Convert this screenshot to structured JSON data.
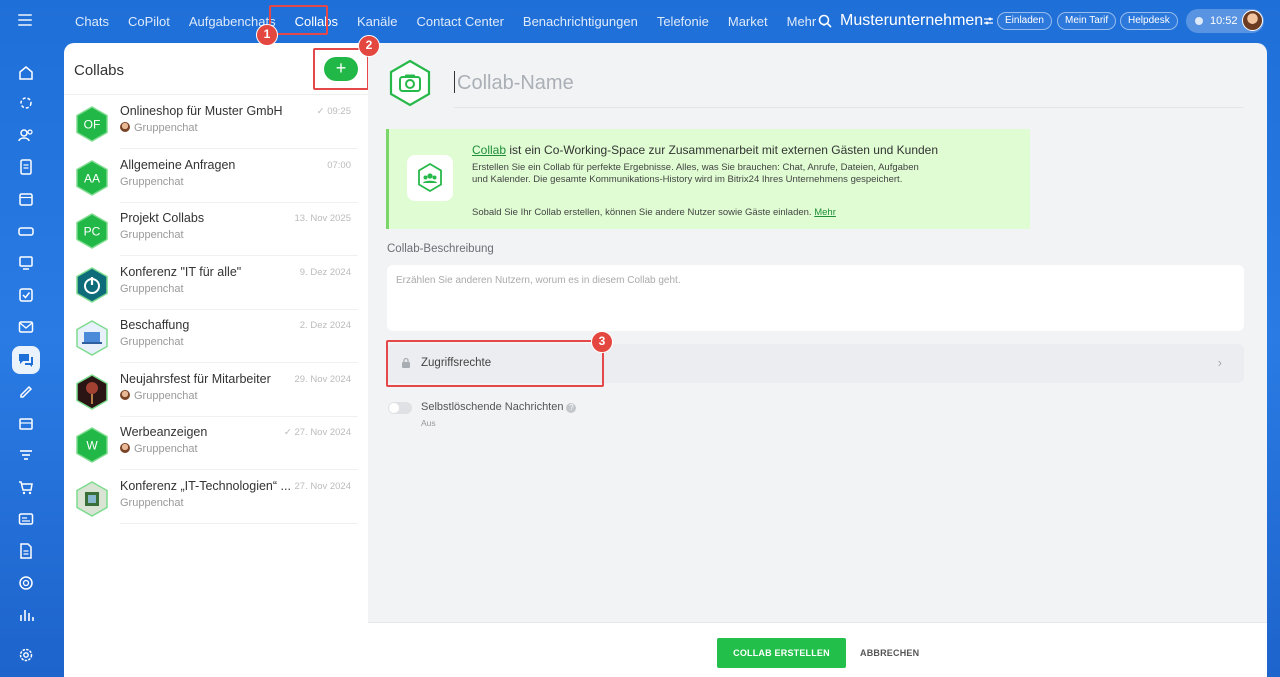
{
  "topbar": {
    "nav": [
      "Chats",
      "CoPilot",
      "Aufgabenchats",
      "Collabs",
      "Kanäle",
      "Contact Center",
      "Benachrichtigungen",
      "Telefonie",
      "Market",
      "Mehr"
    ],
    "mehr_chevron": "⌄",
    "company": "Musterunternehmen",
    "invite": "Einladen",
    "tariff": "Mein Tarif",
    "helpdesk": "Helpdesk",
    "time": "10:52"
  },
  "markers": [
    "1",
    "2",
    "3"
  ],
  "list": {
    "title": "Collabs",
    "add_label": "+",
    "items": [
      {
        "name": "Onlineshop für Muster GmbH",
        "initials": "OF",
        "sub": "Gruppenchat",
        "time": "✓ 09:25",
        "avatar": "hex-green",
        "mini": true
      },
      {
        "name": "Allgemeine Anfragen",
        "initials": "AA",
        "sub": "Gruppenchat",
        "time": "07:00",
        "avatar": "hex-green",
        "mini": false
      },
      {
        "name": "Projekt Collabs",
        "initials": "PC",
        "sub": "Gruppenchat",
        "time": "13. Nov 2025",
        "avatar": "hex-green",
        "mini": false
      },
      {
        "name": "Konferenz \"IT für alle\"",
        "initials": "",
        "sub": "Gruppenchat",
        "time": "9. Dez 2024",
        "avatar": "power",
        "mini": false
      },
      {
        "name": "Beschaffung",
        "initials": "",
        "sub": "Gruppenchat",
        "time": "2. Dez 2024",
        "avatar": "laptop",
        "mini": false
      },
      {
        "name": "Neujahrsfest für Mitarbeiter",
        "initials": "",
        "sub": "Gruppenchat",
        "time": "29. Nov 2024",
        "avatar": "fireworks",
        "mini": true
      },
      {
        "name": "Werbeanzeigen",
        "initials": "W",
        "sub": "Gruppenchat",
        "time": "✓ 27. Nov 2024",
        "avatar": "hex-green",
        "mini": true
      },
      {
        "name": "Konferenz „IT-Technologien“ ...",
        "initials": "",
        "sub": "Gruppenchat",
        "time": "27. Nov 2024",
        "avatar": "chip",
        "mini": false
      }
    ]
  },
  "main": {
    "name_placeholder": "Collab-Name",
    "banner": {
      "link": "Collab",
      "title_rest": " ist ein Co-Working-Space zur Zusammenarbeit mit externen Gästen und Kunden",
      "text": "Erstellen Sie ein Collab für perfekte Ergebnisse. Alles, was Sie brauchen: Chat, Anrufe, Dateien, Aufgaben und Kalender. Die gesamte Kommunikations-History wird im Bitrix24 Ihres Unternehmens gespeichert.",
      "text2": "Sobald Sie Ihr Collab erstellen, können Sie andere Nutzer sowie Gäste einladen. ",
      "more": "Mehr"
    },
    "desc_label": "Collab-Beschreibung",
    "desc_placeholder": "Erzählen Sie anderen Nutzern, worum es in diesem Collab geht.",
    "access_label": "Zugriffsrechte",
    "access_chevron": "›",
    "toggle_label": "Selbstlöschende Nachrichten",
    "toggle_help": "?",
    "toggle_sub": "Aus",
    "create_btn": "COLLAB ERSTELLEN",
    "cancel_btn": "ABBRECHEN"
  },
  "colors": {
    "accent_green": "#22c04a",
    "highlight_red": "#e44848",
    "topbar_blue": "#1f6fd8"
  }
}
